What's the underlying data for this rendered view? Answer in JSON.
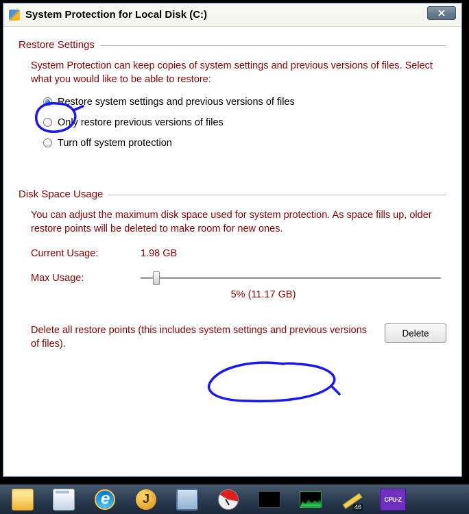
{
  "window": {
    "title": "System Protection for Local Disk (C:)"
  },
  "restore": {
    "heading": "Restore Settings",
    "desc": "System Protection can keep copies of system settings and previous versions of files. Select what you would like to be able to restore:",
    "opt1": "Restore system settings and previous versions of files",
    "opt2": "Only restore previous versions of files",
    "opt3": "Turn off system protection"
  },
  "disk": {
    "heading": "Disk Space Usage",
    "desc": "You can adjust the maximum disk space used for system protection. As space fills up, older restore points will be deleted to make room for new ones.",
    "current_label": "Current Usage:",
    "current_value": "1.98 GB",
    "max_label": "Max Usage:",
    "max_value": "5% (11.17 GB)"
  },
  "delete": {
    "text": "Delete all restore points (this includes system settings and previous versions of files).",
    "button": "Delete"
  },
  "taskbar": {
    "j": "J",
    "temp": "46",
    "cpuz": "CPU·Z"
  }
}
